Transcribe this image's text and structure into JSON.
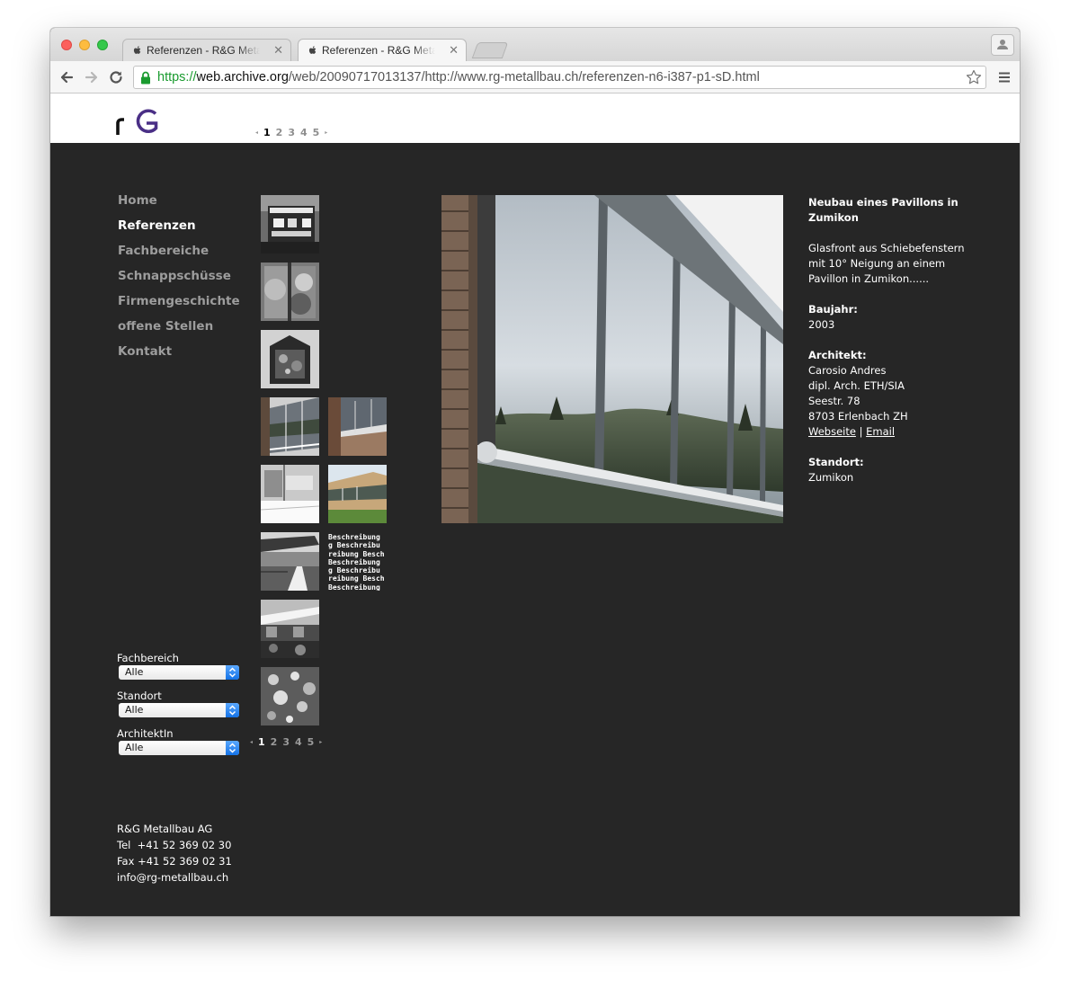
{
  "browser": {
    "tabs": [
      {
        "title": "Referenzen - R&G Metallbau AG"
      },
      {
        "title": "Referenzen - R&G Metallbau AG"
      }
    ],
    "url": {
      "scheme": "https://",
      "host": "web.archive.org",
      "path": "/web/20090717013137/http://www.rg-metallbau.ch/referenzen-n6-i387-p1-sD.html"
    }
  },
  "logo": {
    "text": "rG"
  },
  "pager": {
    "prev": "◂",
    "next": "▸",
    "pages": [
      "1",
      "2",
      "3",
      "4",
      "5"
    ],
    "current": "1"
  },
  "nav": {
    "items": [
      {
        "label": "Home"
      },
      {
        "label": "Referenzen"
      },
      {
        "label": "Fachbereiche"
      },
      {
        "label": "Schnappschüsse"
      },
      {
        "label": "Firmengeschichte"
      },
      {
        "label": "offene Stellen"
      },
      {
        "label": "Kontakt"
      }
    ]
  },
  "thumbnail_text": [
    "Beschreibung",
    "g Beschreibu",
    "reibung Besch",
    "Beschreibung",
    "g Beschreibu",
    "reibung Besch",
    "Beschreibung"
  ],
  "project": {
    "title": "Neubau eines Pavillons in Zumikon",
    "description": "Glasfront aus Schiebefenstern mit 10° Neigung an einem Pavillon in Zumikon......",
    "baujahr_label": "Baujahr:",
    "baujahr": "2003",
    "architekt_label": "Architekt:",
    "architekt_name": "Carosio Andres",
    "architekt_title": "dipl. Arch. ETH/SIA",
    "architekt_street": "Seestr. 78",
    "architekt_city": "8703 Erlenbach ZH",
    "link_website": "Webseite",
    "link_separator": "|",
    "link_email": "Email",
    "standort_label": "Standort:",
    "standort": "Zumikon"
  },
  "filters": [
    {
      "label": "Fachbereich",
      "value": "Alle"
    },
    {
      "label": "Standort",
      "value": "Alle"
    },
    {
      "label": "ArchitektIn",
      "value": "Alle"
    }
  ],
  "footer": {
    "company": "R&G Metallbau AG",
    "tel": "Tel  +41 52 369 02 30",
    "fax": "Fax +41 52 369 02 31",
    "email": "info@rg-metallbau.ch"
  },
  "colors": {
    "page_bg": "#262626",
    "header_bg": "#ffffff",
    "nav_active": "#ffffff",
    "nav_inactive": "#9d9d9d",
    "logo_accent": "#4a2f86",
    "url_scheme": "#1a9b2f"
  }
}
